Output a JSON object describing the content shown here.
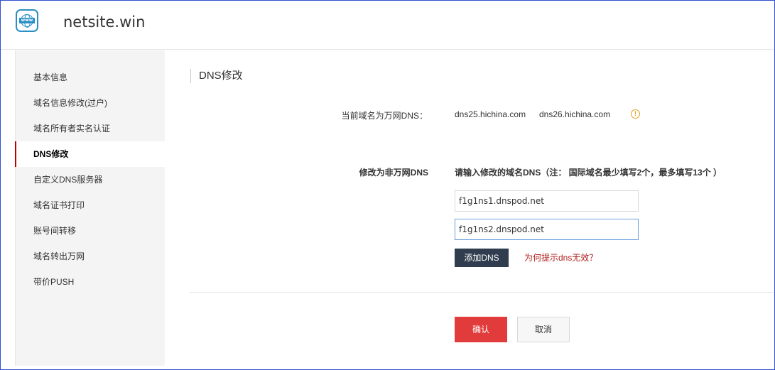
{
  "header": {
    "logo_text": "www",
    "site_name": "netsite.win"
  },
  "sidebar": {
    "items": [
      {
        "label": "基本信息"
      },
      {
        "label": "域名信息修改(过户)"
      },
      {
        "label": "域名所有者实名认证"
      },
      {
        "label": "DNS修改",
        "active": true
      },
      {
        "label": "自定义DNS服务器"
      },
      {
        "label": "域名证书打印"
      },
      {
        "label": "账号间转移"
      },
      {
        "label": "域名转出万网"
      },
      {
        "label": "带价PUSH"
      }
    ]
  },
  "main": {
    "section_title": "DNS修改",
    "current_dns_label": "当前域名为万网DNS：",
    "current_dns": [
      "dns25.hichina.com",
      "dns26.hichina.com"
    ],
    "warn_icon": "!",
    "change_label": "修改为非万网DNS",
    "instruction": "请输入修改的域名DNS（注： 国际域名最少填写2个，最多填写13个 ）",
    "dns_inputs": [
      "f1g1ns1.dnspod.net",
      "f1g1ns2.dnspod.net"
    ],
    "add_button": "添加DNS",
    "help_link": "为何提示dns无效？",
    "confirm_button": "确认",
    "cancel_button": "取消"
  },
  "colors": {
    "accent_red": "#e23b3b",
    "dark_button": "#2f3d4e",
    "link_red": "#b22222",
    "warning": "#e4a020"
  }
}
